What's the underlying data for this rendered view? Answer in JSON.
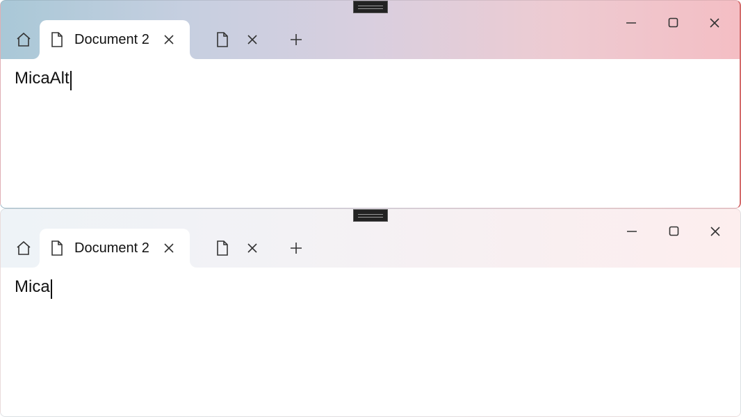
{
  "windows": [
    {
      "theme": "MicaAlt",
      "activeTab": {
        "label": "Document 2"
      },
      "editorText": "MicaAlt"
    },
    {
      "theme": "Mica",
      "activeTab": {
        "label": "Document 2"
      },
      "editorText": "Mica"
    }
  ],
  "icons": {
    "home": "home-icon",
    "document": "document-icon",
    "closeTab": "close-icon",
    "newTab": "plus-icon",
    "minimize": "minimize-icon",
    "maximize": "maximize-icon",
    "closeWindow": "close-icon"
  }
}
